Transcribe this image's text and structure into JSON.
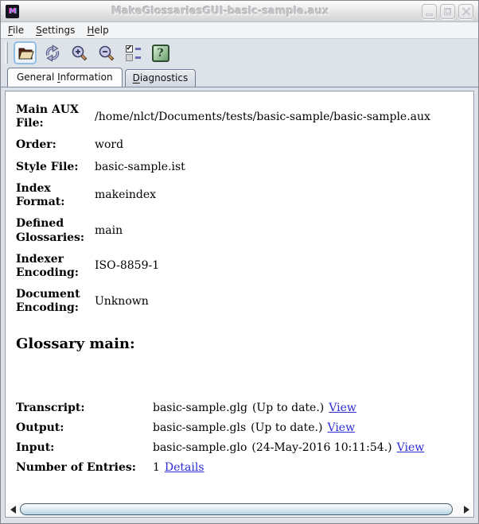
{
  "window": {
    "title": "MakeGlossariesGUI-basic-sample.aux",
    "app_icon_text": "M",
    "titlebar_icons": [
      "app-logo-icon",
      "minimize-icon",
      "maximize-icon",
      "close-icon"
    ]
  },
  "menu": {
    "items": [
      {
        "pre": "",
        "key": "F",
        "post": "ile"
      },
      {
        "pre": "",
        "key": "S",
        "post": "ettings"
      },
      {
        "pre": "",
        "key": "H",
        "post": "elp"
      }
    ]
  },
  "toolbar": {
    "icons": [
      "open-folder-icon",
      "reload-icon",
      "zoom-in-icon",
      "zoom-out-icon",
      "properties-checklist-icon",
      "help-question-icon"
    ]
  },
  "tabs": [
    {
      "pre": "General ",
      "key": "I",
      "post": "nformation",
      "selected": true
    },
    {
      "pre": "",
      "key": "D",
      "post": "iagnostics",
      "selected": false
    }
  ],
  "info": {
    "rows": [
      {
        "label": "Main AUX File:",
        "value": "/home/nlct/Documents/tests/basic-sample/basic-sample.aux"
      },
      {
        "label": "Order:",
        "value": "word"
      },
      {
        "label": "Style File:",
        "value": "basic-sample.ist"
      },
      {
        "label": "Index Format:",
        "value": "makeindex"
      },
      {
        "label": "Defined Glossaries:",
        "value": "main"
      },
      {
        "label": "Indexer Encoding:",
        "value": "ISO-8859-1"
      },
      {
        "label": "Document Encoding:",
        "value": "Unknown"
      }
    ]
  },
  "glossary": {
    "heading": "Glossary main:",
    "rows": [
      {
        "label": "Transcript:",
        "file": "basic-sample.glg",
        "status": "(Up to date.)",
        "link": "View"
      },
      {
        "label": "Output:",
        "file": "basic-sample.gls",
        "status": "(Up to date.)",
        "link": "View"
      },
      {
        "label": "Input:",
        "file": "basic-sample.glo",
        "status": "(24-May-2016 10:11:54.)",
        "link": "View"
      },
      {
        "label": "Number of Entries:",
        "file": "1",
        "status": "",
        "link": "Details"
      }
    ]
  },
  "colors": {
    "link_blue": "#2a2ad6",
    "help_green": "#8cb88d",
    "scroll_thumb_blue": "#c2d9e6",
    "folder_tan": "#ecdcb2",
    "refresh_lavender": "#b9badf"
  }
}
